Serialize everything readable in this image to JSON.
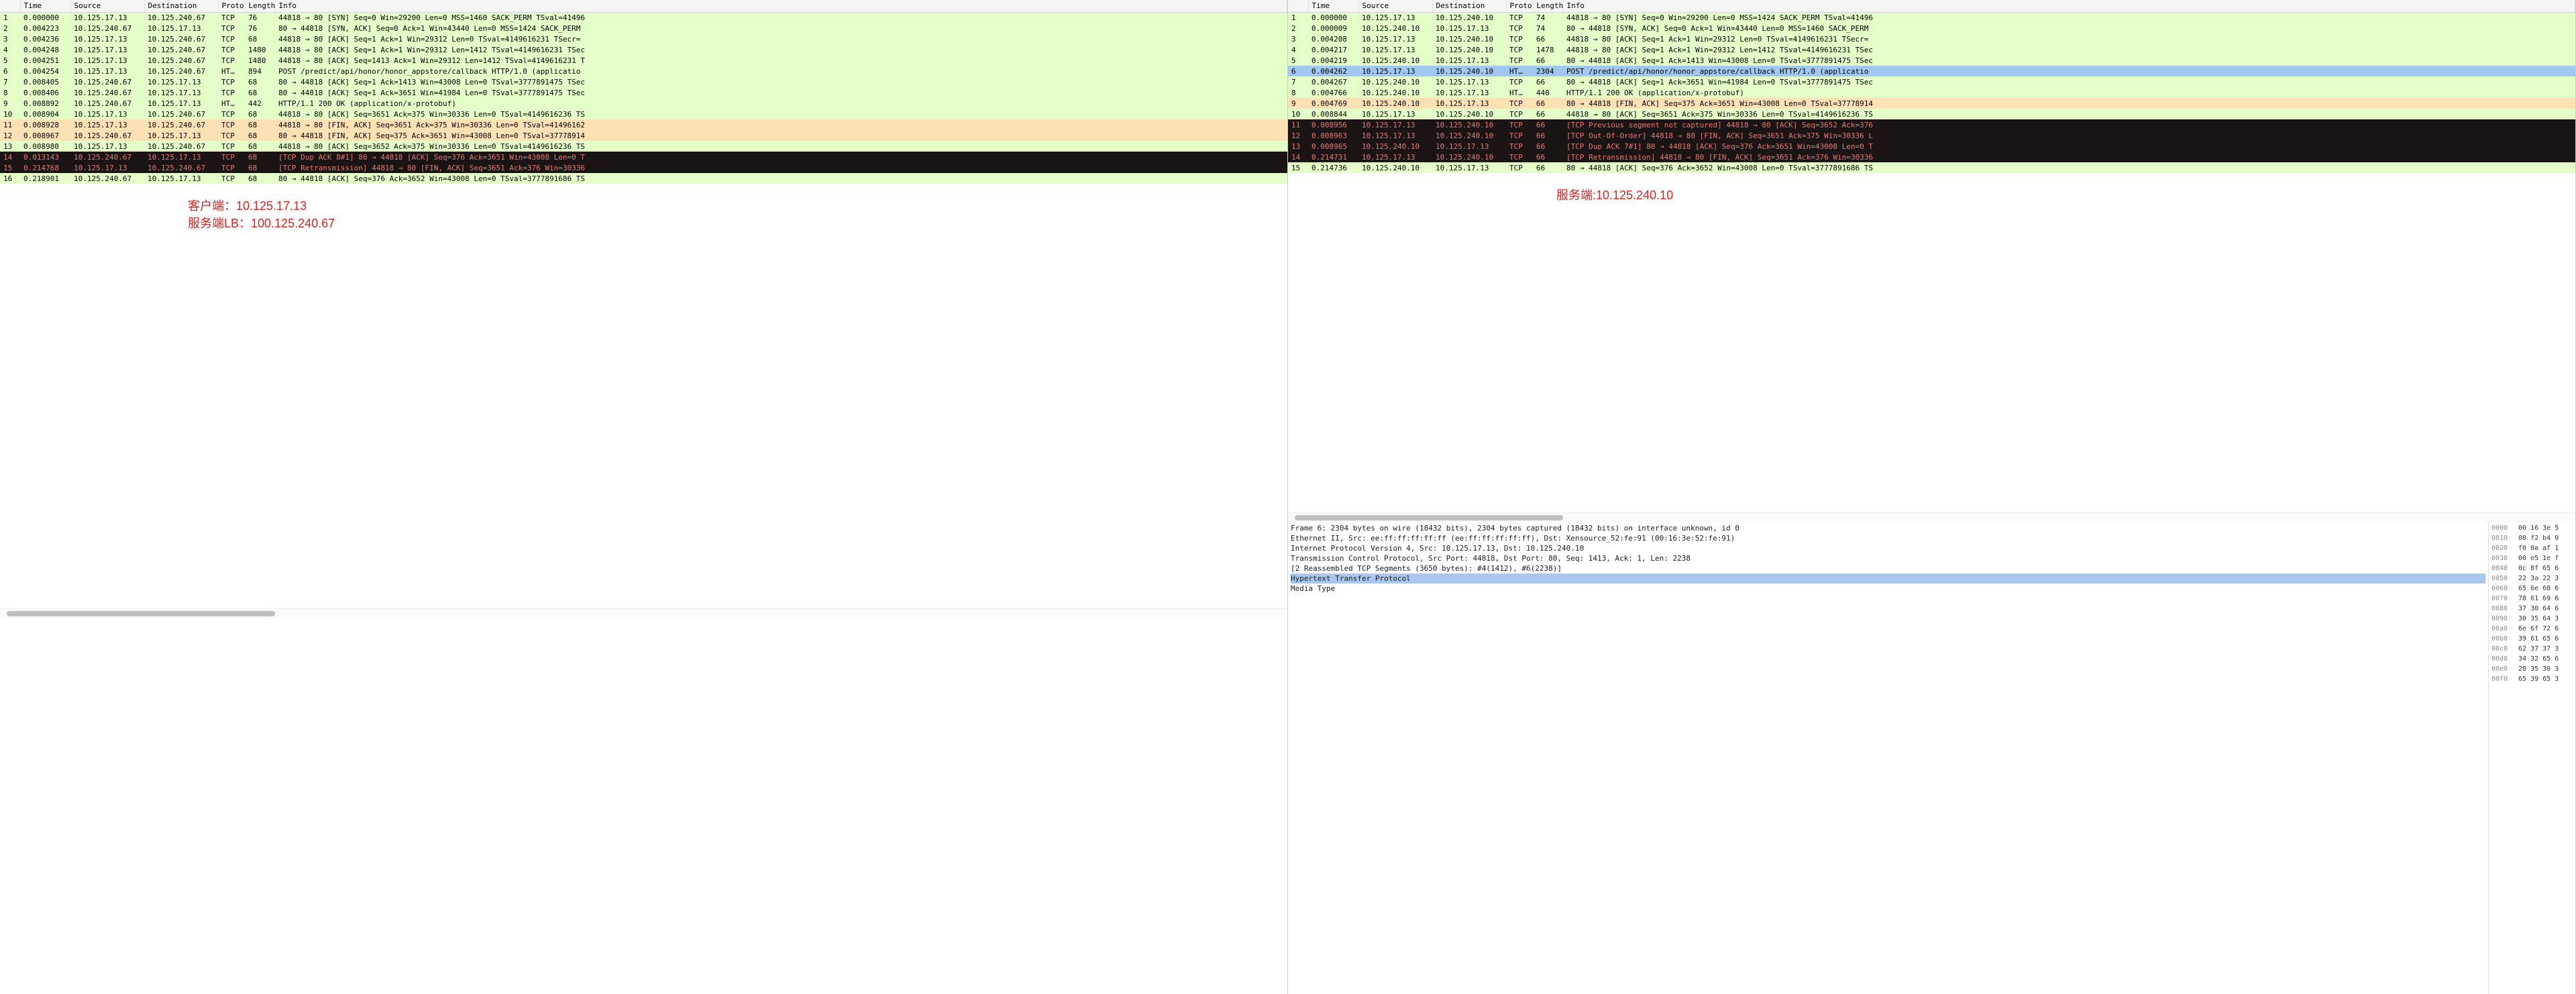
{
  "columns": {
    "num": "",
    "time": "Time",
    "source": "Source",
    "destination": "Destination",
    "proto": "Proto",
    "length": "Length",
    "info": "Info"
  },
  "left": {
    "annotation1": "客户端：10.125.17.13",
    "annotation2": "服务端LB：100.125.240.67",
    "rows": [
      {
        "n": "1",
        "t": "0.000000",
        "s": "10.125.17.13",
        "d": "10.125.240.67",
        "p": "TCP",
        "l": "76",
        "i": "44818 → 80 [SYN] Seq=0 Win=29200 Len=0 MSS=1460 SACK_PERM TSval=41496",
        "cls": "green"
      },
      {
        "n": "2",
        "t": "0.004223",
        "s": "10.125.240.67",
        "d": "10.125.17.13",
        "p": "TCP",
        "l": "76",
        "i": "80 → 44818 [SYN, ACK] Seq=0 Ack=1 Win=43440 Len=0 MSS=1424 SACK_PERM",
        "cls": "green"
      },
      {
        "n": "3",
        "t": "0.004236",
        "s": "10.125.17.13",
        "d": "10.125.240.67",
        "p": "TCP",
        "l": "68",
        "i": "44818 → 80 [ACK] Seq=1 Ack=1 Win=29312 Len=0 TSval=4149616231 TSecr=",
        "cls": "green"
      },
      {
        "n": "4",
        "t": "0.004248",
        "s": "10.125.17.13",
        "d": "10.125.240.67",
        "p": "TCP",
        "l": "1480",
        "i": "44818 → 80 [ACK] Seq=1 Ack=1 Win=29312 Len=1412 TSval=4149616231 TSec",
        "cls": "green"
      },
      {
        "n": "5",
        "t": "0.004251",
        "s": "10.125.17.13",
        "d": "10.125.240.67",
        "p": "TCP",
        "l": "1480",
        "i": "44818 → 80 [ACK] Seq=1413 Ack=1 Win=29312 Len=1412 TSval=4149616231 T",
        "cls": "green"
      },
      {
        "n": "6",
        "t": "0.004254",
        "s": "10.125.17.13",
        "d": "10.125.240.67",
        "p": "HT…",
        "l": "894",
        "i": "POST /predict/api/honor/honor_appstore/callback HTTP/1.0  (applicatio",
        "cls": "green"
      },
      {
        "n": "7",
        "t": "0.008405",
        "s": "10.125.240.67",
        "d": "10.125.17.13",
        "p": "TCP",
        "l": "68",
        "i": "80 → 44818 [ACK] Seq=1 Ack=1413 Win=43008 Len=0 TSval=3777891475 TSec",
        "cls": "green"
      },
      {
        "n": "8",
        "t": "0.008406",
        "s": "10.125.240.67",
        "d": "10.125.17.13",
        "p": "TCP",
        "l": "68",
        "i": "80 → 44818 [ACK] Seq=1 Ack=3651 Win=41984 Len=0 TSval=3777891475 TSec",
        "cls": "green"
      },
      {
        "n": "9",
        "t": "0.008892",
        "s": "10.125.240.67",
        "d": "10.125.17.13",
        "p": "HT…",
        "l": "442",
        "i": "HTTP/1.1 200 OK  (application/x-protobuf)",
        "cls": "green"
      },
      {
        "n": "10",
        "t": "0.008904",
        "s": "10.125.17.13",
        "d": "10.125.240.67",
        "p": "TCP",
        "l": "68",
        "i": "44818 → 80 [ACK] Seq=3651 Ack=375 Win=30336 Len=0 TSval=4149616236 TS",
        "cls": "green"
      },
      {
        "n": "11",
        "t": "0.008928",
        "s": "10.125.17.13",
        "d": "10.125.240.67",
        "p": "TCP",
        "l": "68",
        "i": "44818 → 80 [FIN, ACK] Seq=3651 Ack=375 Win=30336 Len=0 TSval=41496162",
        "cls": "orange"
      },
      {
        "n": "12",
        "t": "0.008967",
        "s": "10.125.240.67",
        "d": "10.125.17.13",
        "p": "TCP",
        "l": "68",
        "i": "80 → 44818 [FIN, ACK] Seq=375 Ack=3651 Win=43008 Len=0 TSval=37778914",
        "cls": "orange"
      },
      {
        "n": "13",
        "t": "0.008980",
        "s": "10.125.17.13",
        "d": "10.125.240.67",
        "p": "TCP",
        "l": "68",
        "i": "44818 → 80 [ACK] Seq=3652 Ack=375 Win=30336 Len=0 TSval=4149616236 TS",
        "cls": "green"
      },
      {
        "n": "14",
        "t": "0.013143",
        "s": "10.125.240.67",
        "d": "10.125.17.13",
        "p": "TCP",
        "l": "68",
        "i": "[TCP Dup ACK 8#1] 80 → 44818 [ACK] Seq=376 Ack=3651 Win=43008 Len=0 T",
        "cls": "dark"
      },
      {
        "n": "15",
        "t": "0.214768",
        "s": "10.125.17.13",
        "d": "10.125.240.67",
        "p": "TCP",
        "l": "68",
        "i": "[TCP Retransmission] 44818 → 80 [FIN, ACK] Seq=3651 Ack=376 Win=30336",
        "cls": "dark"
      },
      {
        "n": "16",
        "t": "0.218901",
        "s": "10.125.240.67",
        "d": "10.125.17.13",
        "p": "TCP",
        "l": "68",
        "i": "80 → 44818 [ACK] Seq=376 Ack=3652 Win=43008 Len=0 TSval=3777891686 TS",
        "cls": "green"
      }
    ]
  },
  "right": {
    "annotation1": "服务端:10.125.240.10",
    "rows": [
      {
        "n": "1",
        "t": "0.000000",
        "s": "10.125.17.13",
        "d": "10.125.240.10",
        "p": "TCP",
        "l": "74",
        "i": "44818 → 80 [SYN] Seq=0 Win=29200 Len=0 MSS=1424 SACK_PERM TSval=41496",
        "cls": "green"
      },
      {
        "n": "2",
        "t": "0.000009",
        "s": "10.125.240.10",
        "d": "10.125.17.13",
        "p": "TCP",
        "l": "74",
        "i": "80 → 44818 [SYN, ACK] Seq=0 Ack=1 Win=43440 Len=0 MSS=1460 SACK_PERM",
        "cls": "green"
      },
      {
        "n": "3",
        "t": "0.004208",
        "s": "10.125.17.13",
        "d": "10.125.240.10",
        "p": "TCP",
        "l": "66",
        "i": "44818 → 80 [ACK] Seq=1 Ack=1 Win=29312 Len=0 TSval=4149616231 TSecr=",
        "cls": "green"
      },
      {
        "n": "4",
        "t": "0.004217",
        "s": "10.125.17.13",
        "d": "10.125.240.10",
        "p": "TCP",
        "l": "1478",
        "i": "44818 → 80 [ACK] Seq=1 Ack=1 Win=29312 Len=1412 TSval=4149616231 TSec",
        "cls": "green"
      },
      {
        "n": "5",
        "t": "0.004219",
        "s": "10.125.240.10",
        "d": "10.125.17.13",
        "p": "TCP",
        "l": "66",
        "i": "80 → 44818 [ACK] Seq=1 Ack=1413 Win=43008 Len=0 TSval=3777891475 TSec",
        "cls": "green"
      },
      {
        "n": "6",
        "t": "0.004262",
        "s": "10.125.17.13",
        "d": "10.125.240.10",
        "p": "HT…",
        "l": "2304",
        "i": "POST /predict/api/honor/honor_appstore/callback HTTP/1.0  (applicatio",
        "cls": "blue"
      },
      {
        "n": "7",
        "t": "0.004267",
        "s": "10.125.240.10",
        "d": "10.125.17.13",
        "p": "TCP",
        "l": "66",
        "i": "80 → 44818 [ACK] Seq=1 Ack=3651 Win=41984 Len=0 TSval=3777891475 TSec",
        "cls": "green"
      },
      {
        "n": "8",
        "t": "0.004766",
        "s": "10.125.240.10",
        "d": "10.125.17.13",
        "p": "HT…",
        "l": "440",
        "i": "HTTP/1.1 200 OK  (application/x-protobuf)",
        "cls": "green"
      },
      {
        "n": "9",
        "t": "0.004769",
        "s": "10.125.240.10",
        "d": "10.125.17.13",
        "p": "TCP",
        "l": "66",
        "i": "80 → 44818 [FIN, ACK] Seq=375 Ack=3651 Win=43008 Len=0 TSval=37778914",
        "cls": "orange"
      },
      {
        "n": "10",
        "t": "0.008844",
        "s": "10.125.17.13",
        "d": "10.125.240.10",
        "p": "TCP",
        "l": "66",
        "i": "44818 → 80 [ACK] Seq=3651 Ack=375 Win=30336 Len=0 TSval=4149616236 TS",
        "cls": "green"
      },
      {
        "n": "11",
        "t": "0.008956",
        "s": "10.125.17.13",
        "d": "10.125.240.10",
        "p": "TCP",
        "l": "66",
        "i": "[TCP Previous segment not captured] 44818 → 80 [ACK] Seq=3652 Ack=376",
        "cls": "dark"
      },
      {
        "n": "12",
        "t": "0.008963",
        "s": "10.125.17.13",
        "d": "10.125.240.10",
        "p": "TCP",
        "l": "66",
        "i": "[TCP Out-Of-Order] 44818 → 80 [FIN, ACK] Seq=3651 Ack=375 Win=30336 L",
        "cls": "dark"
      },
      {
        "n": "13",
        "t": "0.008965",
        "s": "10.125.240.10",
        "d": "10.125.17.13",
        "p": "TCP",
        "l": "66",
        "i": "[TCP Dup ACK 7#1] 80 → 44818 [ACK] Seq=376 Ack=3651 Win=43008 Len=0 T",
        "cls": "dark"
      },
      {
        "n": "14",
        "t": "0.214731",
        "s": "10.125.17.13",
        "d": "10.125.240.10",
        "p": "TCP",
        "l": "66",
        "i": "[TCP Retransmission] 44818 → 80 [FIN, ACK] Seq=3651 Ack=376 Win=30336",
        "cls": "dark"
      },
      {
        "n": "15",
        "t": "0.214736",
        "s": "10.125.240.10",
        "d": "10.125.17.13",
        "p": "TCP",
        "l": "66",
        "i": "80 → 44818 [ACK] Seq=376 Ack=3652 Win=43008 Len=0 TSval=3777891686 TS",
        "cls": "green"
      }
    ],
    "detail": [
      {
        "t": "Frame 6: 2304 bytes on wire (18432 bits), 2304 bytes captured (18432 bits) on interface unknown, id 0",
        "sel": false
      },
      {
        "t": "Ethernet II, Src: ee:ff:ff:ff:ff:ff (ee:ff:ff:ff:ff:ff), Dst: Xensource_52:fe:91 (00:16:3e:52:fe:91)",
        "sel": false
      },
      {
        "t": "Internet Protocol Version 4, Src: 10.125.17.13, Dst: 10.125.240.10",
        "sel": false
      },
      {
        "t": "Transmission Control Protocol, Src Port: 44818, Dst Port: 80, Seq: 1413, Ack: 1, Len: 2238",
        "sel": false
      },
      {
        "t": "[2 Reassembled TCP Segments (3650 bytes): #4(1412), #6(2238)]",
        "sel": false
      },
      {
        "t": "Hypertext Transfer Protocol",
        "sel": true
      },
      {
        "t": "Media Type",
        "sel": false
      }
    ],
    "hex": [
      {
        "o": "0000",
        "b": "00 16 3e 5"
      },
      {
        "o": "0010",
        "b": "08 f2 b4 0"
      },
      {
        "o": "0020",
        "b": "f0 0a af 1"
      },
      {
        "o": "0030",
        "b": "00 e5 1e f"
      },
      {
        "o": "0040",
        "b": "0c 8f 65 6"
      },
      {
        "o": "0050",
        "b": "22 3a 22 3"
      },
      {
        "o": "0060",
        "b": "65 6e 68 6"
      },
      {
        "o": "0070",
        "b": "78 61 69 6"
      },
      {
        "o": "0080",
        "b": "37 30 64 6"
      },
      {
        "o": "0090",
        "b": "30 35 64 3"
      },
      {
        "o": "00a0",
        "b": "6e 6f 72 6"
      },
      {
        "o": "00b0",
        "b": "39 61 65 6"
      },
      {
        "o": "00c0",
        "b": "62 37 37 3"
      },
      {
        "o": "00d0",
        "b": "34 32 65 6"
      },
      {
        "o": "00e0",
        "b": "28 35 30 3"
      },
      {
        "o": "00f0",
        "b": "65 39 65 3"
      }
    ]
  }
}
